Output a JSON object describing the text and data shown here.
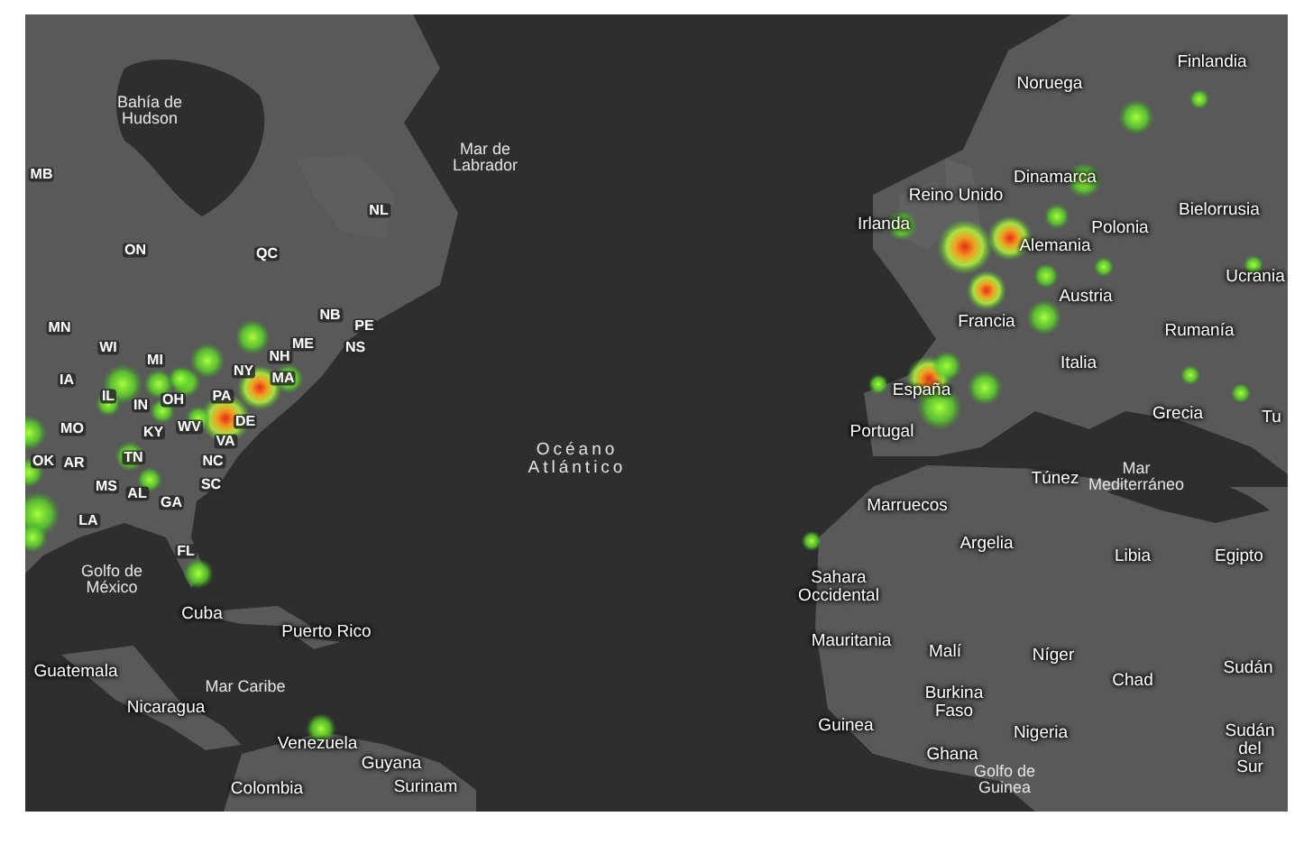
{
  "map": {
    "labels": [
      {
        "text": "Bahía de\nHudson",
        "kind": "water"
      },
      {
        "text": "MB",
        "kind": "state"
      },
      {
        "text": "ON",
        "kind": "state"
      },
      {
        "text": "QC",
        "kind": "state"
      },
      {
        "text": "NL",
        "kind": "state"
      },
      {
        "text": "MN",
        "kind": "state"
      },
      {
        "text": "WI",
        "kind": "state"
      },
      {
        "text": "MI",
        "kind": "state"
      },
      {
        "text": "NB",
        "kind": "state"
      },
      {
        "text": "PE",
        "kind": "state"
      },
      {
        "text": "ME",
        "kind": "state"
      },
      {
        "text": "NS",
        "kind": "state"
      },
      {
        "text": "NH",
        "kind": "state"
      },
      {
        "text": "NY",
        "kind": "state"
      },
      {
        "text": "MA",
        "kind": "state"
      },
      {
        "text": "IA",
        "kind": "state"
      },
      {
        "text": "IL",
        "kind": "state"
      },
      {
        "text": "IN",
        "kind": "state"
      },
      {
        "text": "OH",
        "kind": "state"
      },
      {
        "text": "PA",
        "kind": "state"
      },
      {
        "text": "WV",
        "kind": "state"
      },
      {
        "text": "DE",
        "kind": "state"
      },
      {
        "text": "MO",
        "kind": "state"
      },
      {
        "text": "KY",
        "kind": "state"
      },
      {
        "text": "VA",
        "kind": "state"
      },
      {
        "text": "OK",
        "kind": "state"
      },
      {
        "text": "AR",
        "kind": "state"
      },
      {
        "text": "TN",
        "kind": "state"
      },
      {
        "text": "NC",
        "kind": "state"
      },
      {
        "text": "MS",
        "kind": "state"
      },
      {
        "text": "AL",
        "kind": "state"
      },
      {
        "text": "SC",
        "kind": "state"
      },
      {
        "text": "GA",
        "kind": "state"
      },
      {
        "text": "LA",
        "kind": "state"
      },
      {
        "text": "FL",
        "kind": "state"
      },
      {
        "text": "Golfo de\nMéxico",
        "kind": "water"
      },
      {
        "text": "Cuba",
        "kind": "country"
      },
      {
        "text": "Puerto Rico",
        "kind": "country"
      },
      {
        "text": "Guatemala",
        "kind": "country"
      },
      {
        "text": "Mar Caribe",
        "kind": "water"
      },
      {
        "text": "Nicaragua",
        "kind": "country"
      },
      {
        "text": "Venezuela",
        "kind": "country"
      },
      {
        "text": "Guyana",
        "kind": "country"
      },
      {
        "text": "Colombia",
        "kind": "country"
      },
      {
        "text": "Surinam",
        "kind": "country"
      },
      {
        "text": "Mar de\nLabrador",
        "kind": "water"
      },
      {
        "text": "Océano\nAtlántico",
        "kind": "ocean"
      },
      {
        "text": "Noruega",
        "kind": "country"
      },
      {
        "text": "Finlandia",
        "kind": "country"
      },
      {
        "text": "Dinamarca",
        "kind": "country"
      },
      {
        "text": "Reino Unido",
        "kind": "country"
      },
      {
        "text": "Irlanda",
        "kind": "country"
      },
      {
        "text": "Polonia",
        "kind": "country"
      },
      {
        "text": "Bielorrusia",
        "kind": "country"
      },
      {
        "text": "Alemania",
        "kind": "country"
      },
      {
        "text": "Ucrania",
        "kind": "country"
      },
      {
        "text": "Austria",
        "kind": "country"
      },
      {
        "text": "Francia",
        "kind": "country"
      },
      {
        "text": "Rumanía",
        "kind": "country"
      },
      {
        "text": "Italia",
        "kind": "country"
      },
      {
        "text": "España",
        "kind": "country"
      },
      {
        "text": "Grecia",
        "kind": "country"
      },
      {
        "text": "Tu",
        "kind": "country"
      },
      {
        "text": "Portugal",
        "kind": "country"
      },
      {
        "text": "Túnez",
        "kind": "country"
      },
      {
        "text": "Mar\nMediterráneo",
        "kind": "water"
      },
      {
        "text": "Marruecos",
        "kind": "country"
      },
      {
        "text": "Argelia",
        "kind": "country"
      },
      {
        "text": "Libia",
        "kind": "country"
      },
      {
        "text": "Egipto",
        "kind": "country"
      },
      {
        "text": "Sahara\nOccidental",
        "kind": "country"
      },
      {
        "text": "Mauritania",
        "kind": "country"
      },
      {
        "text": "Malí",
        "kind": "country"
      },
      {
        "text": "Níger",
        "kind": "country"
      },
      {
        "text": "Chad",
        "kind": "country"
      },
      {
        "text": "Sudán",
        "kind": "country"
      },
      {
        "text": "Burkina\nFaso",
        "kind": "country"
      },
      {
        "text": "Guinea",
        "kind": "country"
      },
      {
        "text": "Nigeria",
        "kind": "country"
      },
      {
        "text": "Ghana",
        "kind": "country"
      },
      {
        "text": "Sudán\ndel Sur",
        "kind": "country"
      },
      {
        "text": "Golfo de\nGuinea",
        "kind": "water"
      }
    ]
  }
}
